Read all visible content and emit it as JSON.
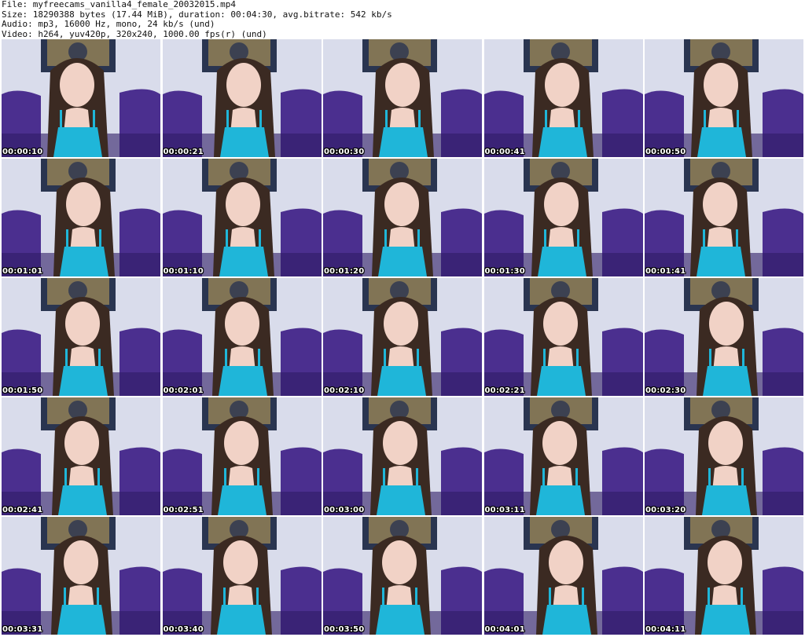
{
  "header": {
    "file_line": "File: myfreecams_vanilla4_female_20032015.mp4",
    "size_line": "Size: 18290388 bytes (17.44 MiB), duration: 00:04:30, avg.bitrate: 542 kb/s",
    "audio_line": "Audio: mp3, 16000 Hz, mono, 24 kb/s (und)",
    "video_line": "Video: h264, yuv420p, 320x240, 1000.00 fps(r) (und)"
  },
  "thumbnails": [
    {
      "time": "00:00:10"
    },
    {
      "time": "00:00:21"
    },
    {
      "time": "00:00:30"
    },
    {
      "time": "00:00:41"
    },
    {
      "time": "00:00:50"
    },
    {
      "time": "00:01:01"
    },
    {
      "time": "00:01:10"
    },
    {
      "time": "00:01:20"
    },
    {
      "time": "00:01:30"
    },
    {
      "time": "00:01:41"
    },
    {
      "time": "00:01:50"
    },
    {
      "time": "00:02:01"
    },
    {
      "time": "00:02:10"
    },
    {
      "time": "00:02:21"
    },
    {
      "time": "00:02:30"
    },
    {
      "time": "00:02:41"
    },
    {
      "time": "00:02:51"
    },
    {
      "time": "00:03:00"
    },
    {
      "time": "00:03:11"
    },
    {
      "time": "00:03:20"
    },
    {
      "time": "00:03:31"
    },
    {
      "time": "00:03:40"
    },
    {
      "time": "00:03:50"
    },
    {
      "time": "00:04:01"
    },
    {
      "time": "00:04:11"
    }
  ],
  "colors": {
    "wall": "#d9dceb",
    "sofa": "#4b2f8f",
    "sofa_shadow": "#2f1d66",
    "frame": "#2a3550",
    "frame_inner": "#c8a85a",
    "hair": "#3b2a22",
    "skin": "#f1d2c6",
    "top": "#1fb6d9"
  }
}
